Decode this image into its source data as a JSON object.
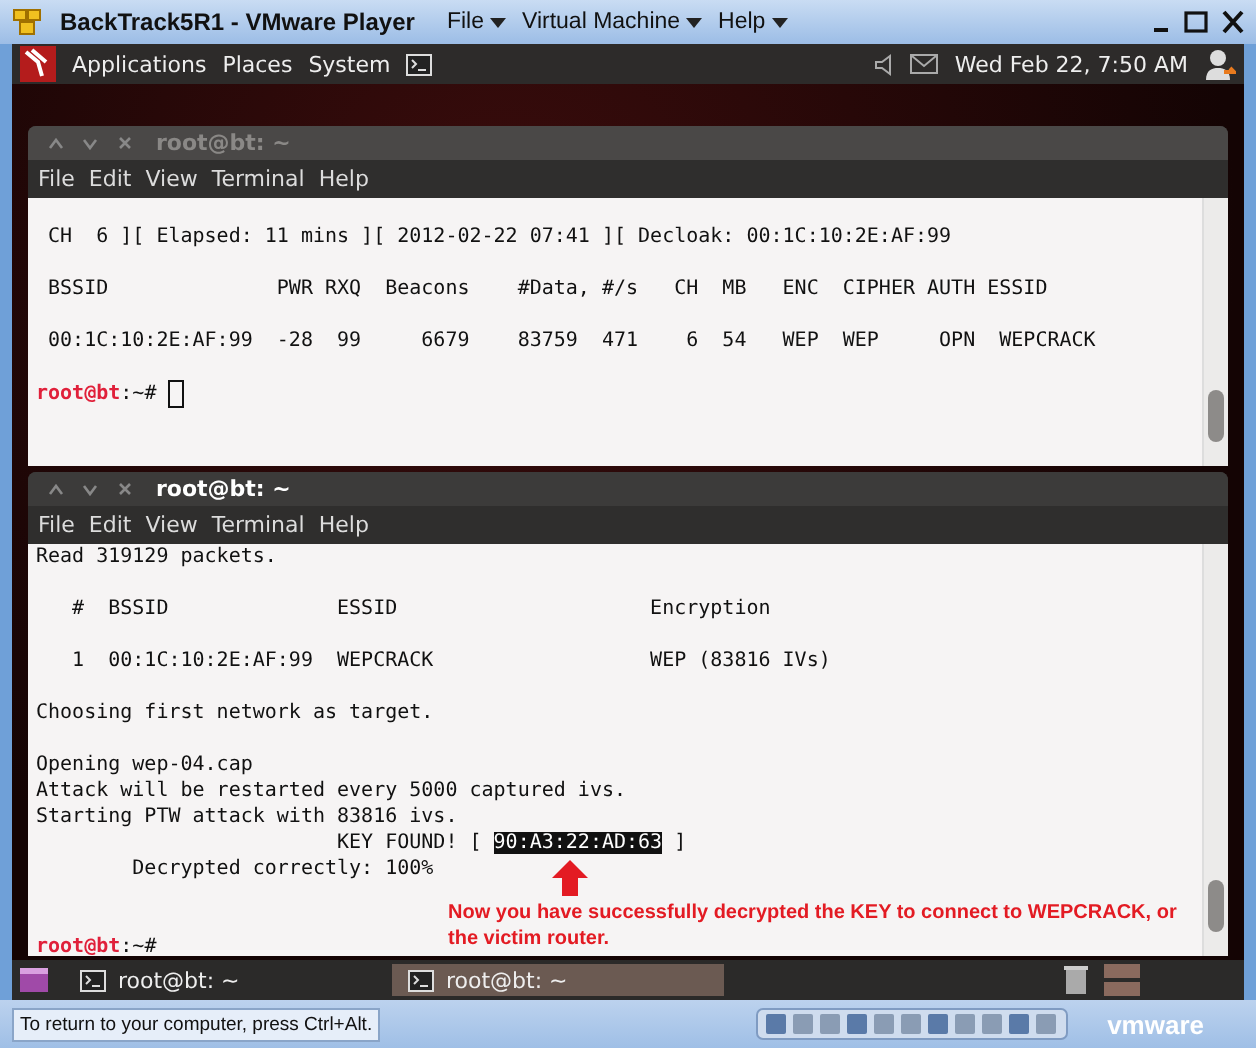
{
  "vm_window": {
    "title": "BackTrack5R1 - VMware Player",
    "menus": [
      "File",
      "Virtual Machine",
      "Help"
    ]
  },
  "top_panel": {
    "menus": [
      "Applications",
      "Places",
      "System"
    ],
    "clock": "Wed Feb 22,  7:50 AM"
  },
  "terminals": [
    {
      "title": "root@bt: ~",
      "focused": false,
      "menu": [
        "File",
        "Edit",
        "View",
        "Terminal",
        "Help"
      ],
      "lines": [
        {
          "kind": "blank"
        },
        {
          "kind": "text",
          "text": " CH  6 ][ Elapsed: 11 mins ][ 2012-02-22 07:41 ][ Decloak: 00:1C:10:2E:AF:99"
        },
        {
          "kind": "blank"
        },
        {
          "kind": "text",
          "text": " BSSID              PWR RXQ  Beacons    #Data, #/s   CH  MB   ENC  CIPHER AUTH ESSID"
        },
        {
          "kind": "blank"
        },
        {
          "kind": "text",
          "text": " 00:1C:10:2E:AF:99  -28  99     6679    83759  471    6  54   WEP  WEP     OPN  WEPCRACK"
        },
        {
          "kind": "blank"
        },
        {
          "kind": "prompt",
          "user": "root@bt",
          "path": ":~#",
          "cursor": true
        }
      ]
    },
    {
      "title": "root@bt: ~",
      "focused": true,
      "menu": [
        "File",
        "Edit",
        "View",
        "Terminal",
        "Help"
      ],
      "lines": [
        {
          "kind": "text",
          "text": "Read 319129 packets."
        },
        {
          "kind": "blank"
        },
        {
          "kind": "text",
          "text": "   #  BSSID              ESSID                     Encryption"
        },
        {
          "kind": "blank"
        },
        {
          "kind": "text",
          "text": "   1  00:1C:10:2E:AF:99  WEPCRACK                  WEP (83816 IVs)"
        },
        {
          "kind": "blank"
        },
        {
          "kind": "text",
          "text": "Choosing first network as target."
        },
        {
          "kind": "blank"
        },
        {
          "kind": "text",
          "text": "Opening wep-04.cap"
        },
        {
          "kind": "text",
          "text": "Attack will be restarted every 5000 captured ivs."
        },
        {
          "kind": "text",
          "text": "Starting PTW attack with 83816 ivs."
        },
        {
          "kind": "key",
          "before": "                         KEY FOUND! [ ",
          "key": "90:A3:22:AD:63",
          "after": " ]"
        },
        {
          "kind": "text",
          "text": "        Decrypted correctly: 100%"
        },
        {
          "kind": "blank"
        },
        {
          "kind": "blank"
        },
        {
          "kind": "prompt",
          "user": "root@bt",
          "path": ":~#",
          "cursor": false
        }
      ]
    }
  ],
  "annotation": {
    "text": "Now you have successfully decrypted the KEY to connect to WEPCRACK, or the victim router."
  },
  "taskbar": {
    "items": [
      {
        "label": "root@bt: ~",
        "selected": false
      },
      {
        "label": "root@bt: ~",
        "selected": true
      }
    ]
  },
  "status_bar": {
    "hint": "To return to your computer, press Ctrl+Alt.",
    "logo": "vmware"
  }
}
